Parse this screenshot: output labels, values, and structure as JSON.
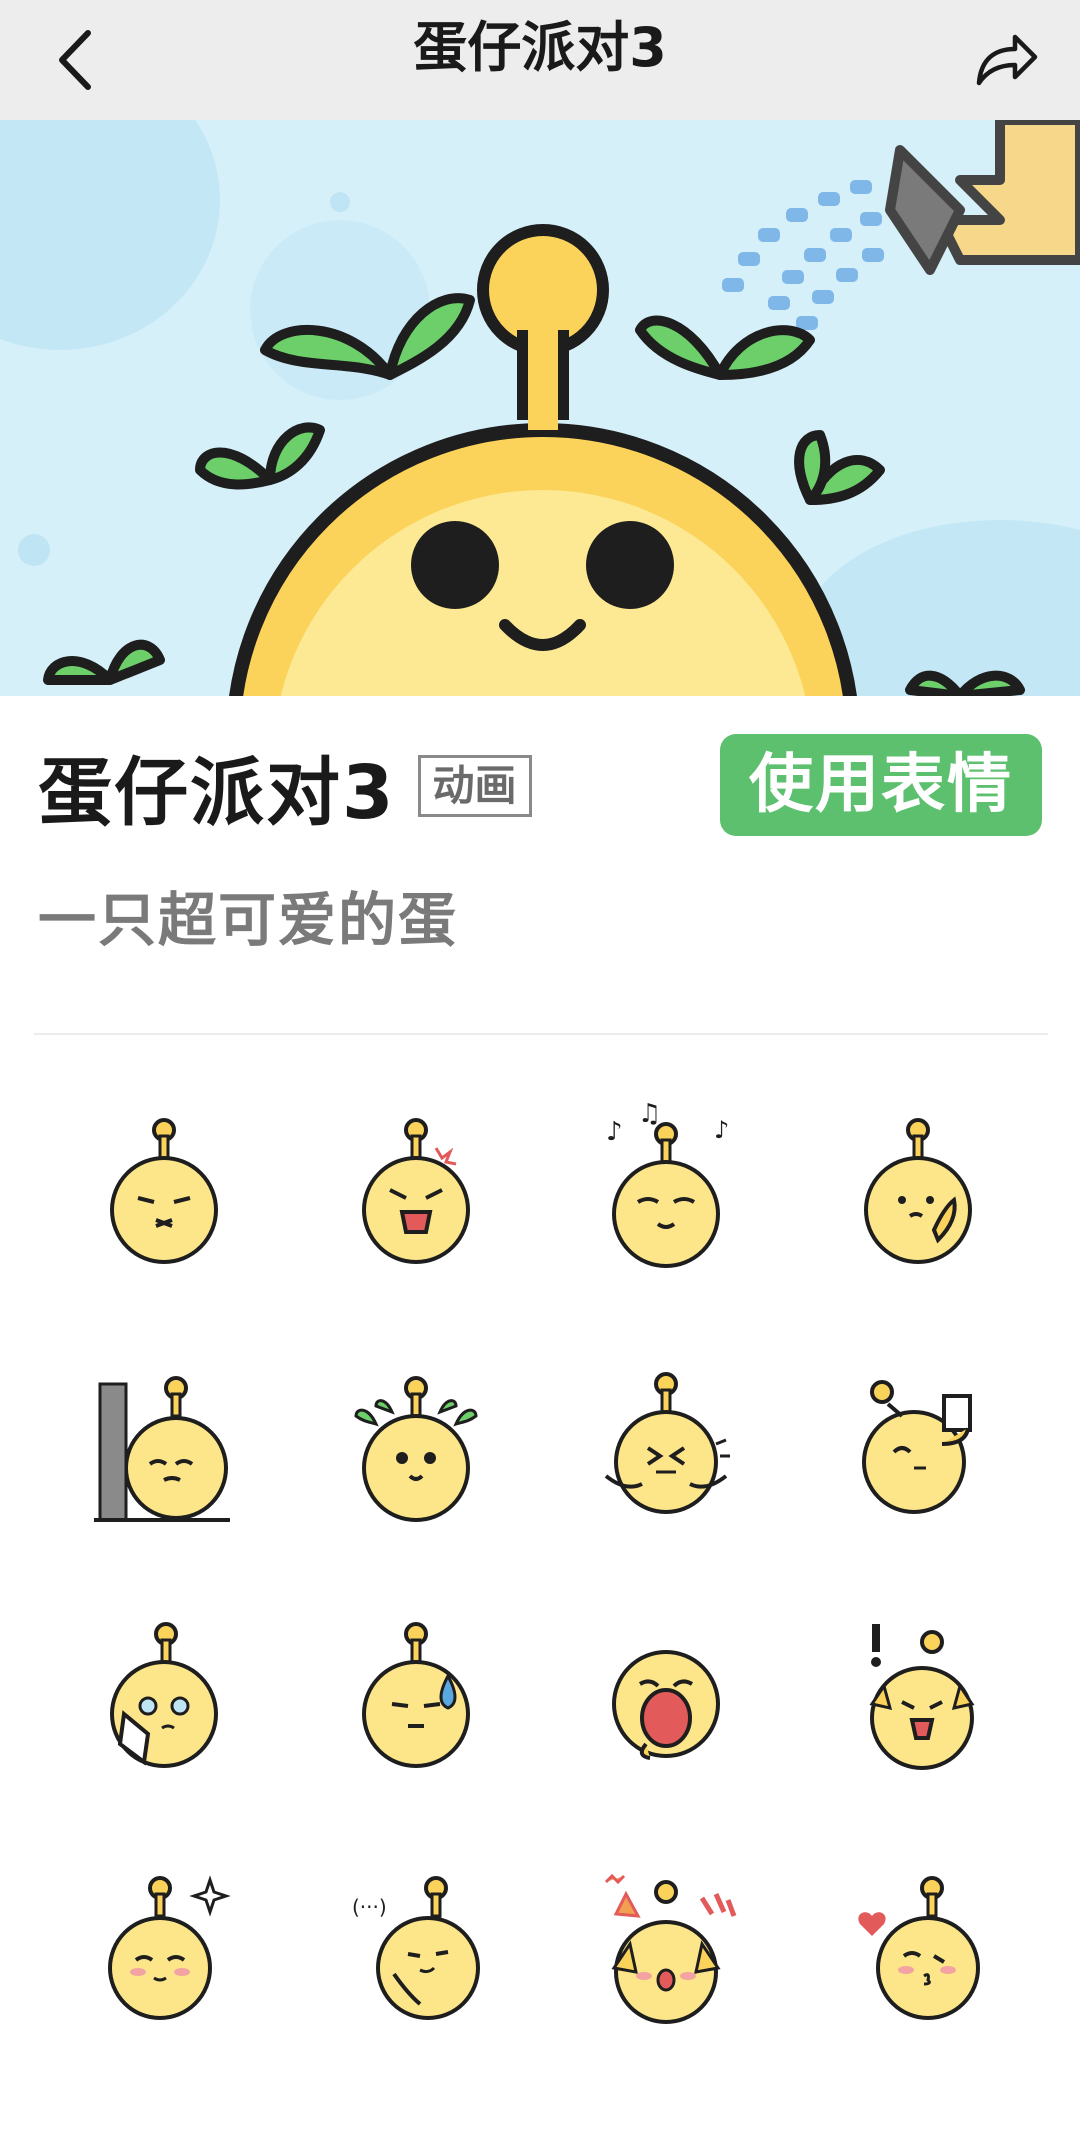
{
  "nav": {
    "title": "蛋仔派对3",
    "back_icon": "chevron-left-icon",
    "share_icon": "share-arrow-icon"
  },
  "banner": {
    "image": "egg-character-with-sprouts-watering-can-banner"
  },
  "pack": {
    "title": "蛋仔派对3",
    "badge": "动画",
    "use_button_label": "使用表情",
    "description": "一只超可爱的蛋"
  },
  "colors": {
    "nav_bg": "#ededed",
    "accent_green": "#5cc06e",
    "banner_sky": "#d6f0fa",
    "egg_yellow": "#fbe07a",
    "egg_outline": "#1e1e1e",
    "sprout_green": "#6dcf6a"
  },
  "stickers": [
    {
      "name": "egg-annoyed"
    },
    {
      "name": "egg-angry-shout"
    },
    {
      "name": "egg-singing-notes"
    },
    {
      "name": "egg-hand-covering"
    },
    {
      "name": "egg-peeking-behind-wall"
    },
    {
      "name": "egg-sprouts-smile"
    },
    {
      "name": "egg-shivering"
    },
    {
      "name": "egg-holding-cup"
    },
    {
      "name": "egg-crying-tissue"
    },
    {
      "name": "egg-sweat-drop"
    },
    {
      "name": "egg-yawning"
    },
    {
      "name": "egg-surprised-exclaim"
    },
    {
      "name": "egg-sparkle-blush"
    },
    {
      "name": "egg-whisper-dots"
    },
    {
      "name": "egg-celebrate-party"
    },
    {
      "name": "egg-heart-kiss"
    }
  ]
}
